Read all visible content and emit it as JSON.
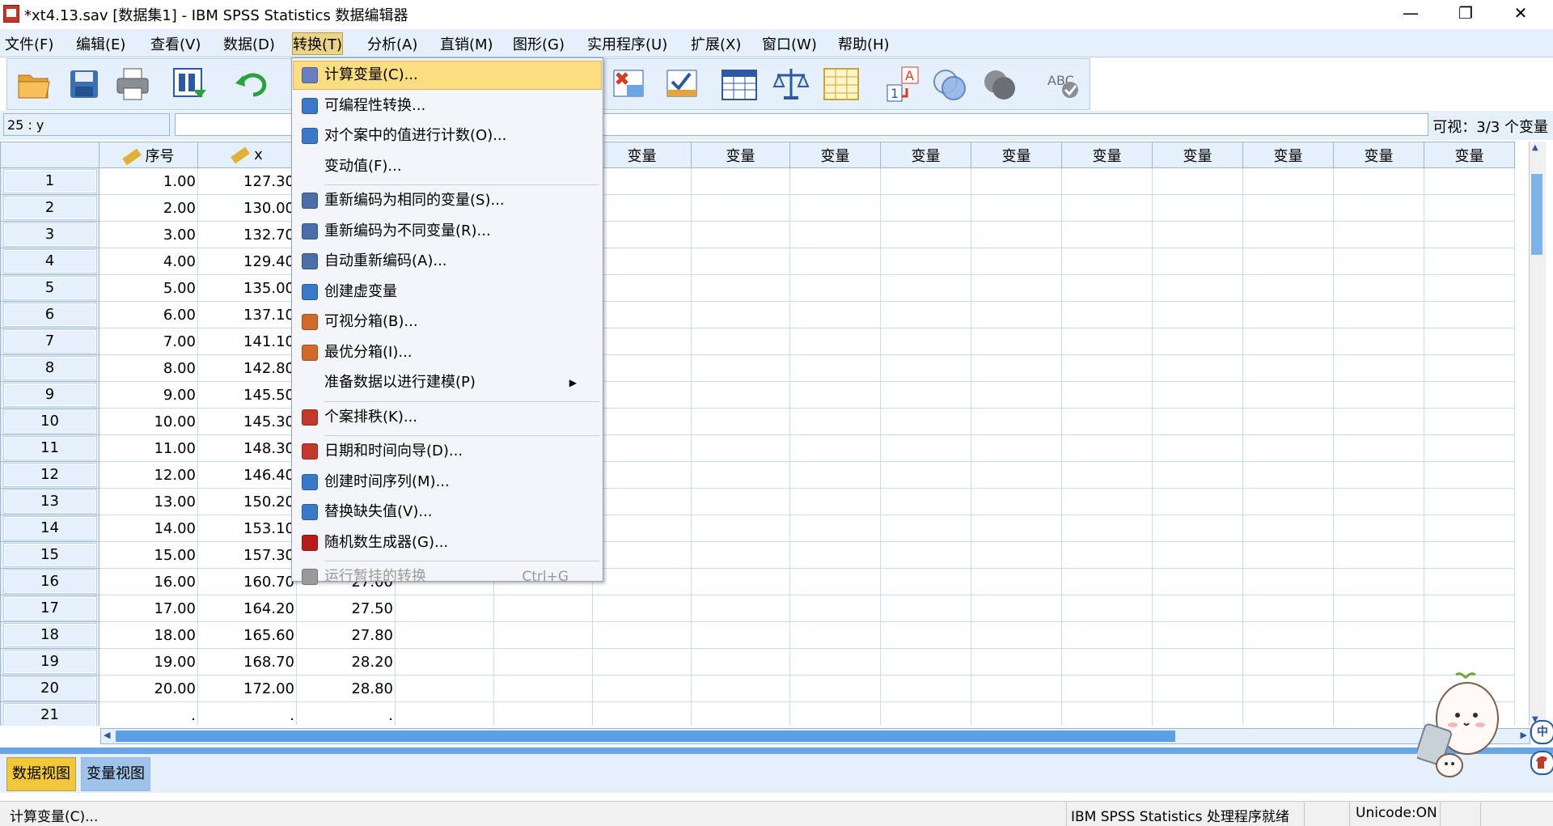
{
  "window": {
    "title": "*xt4.13.sav [数据集1] - IBM SPSS Statistics 数据编辑器",
    "minimize": "—",
    "restore": "❐",
    "close": "✕"
  },
  "menubar": [
    {
      "label": "文件(F)"
    },
    {
      "label": "编辑(E)"
    },
    {
      "label": "查看(V)"
    },
    {
      "label": "数据(D)"
    },
    {
      "label": "转换(T)"
    },
    {
      "label": "分析(A)"
    },
    {
      "label": "直销(M)"
    },
    {
      "label": "图形(G)"
    },
    {
      "label": "实用程序(U)"
    },
    {
      "label": "扩展(X)"
    },
    {
      "label": "窗口(W)"
    },
    {
      "label": "帮助(H)"
    }
  ],
  "cellbar": {
    "ref": "25 : y",
    "visible": "可视：3/3 个变量"
  },
  "grid": {
    "columns": [
      "序号",
      "x",
      "y",
      "变量",
      "变量",
      "变量",
      "变量",
      "变量",
      "变量",
      "变量",
      "变量",
      "变量",
      "变量",
      "变量",
      "变量"
    ],
    "rows": [
      [
        "1",
        "1.00",
        "127.30",
        ""
      ],
      [
        "2",
        "2.00",
        "130.00",
        ""
      ],
      [
        "3",
        "3.00",
        "132.70",
        ""
      ],
      [
        "4",
        "4.00",
        "129.40",
        ""
      ],
      [
        "5",
        "5.00",
        "135.00",
        ""
      ],
      [
        "6",
        "6.00",
        "137.10",
        ""
      ],
      [
        "7",
        "7.00",
        "141.10",
        ""
      ],
      [
        "8",
        "8.00",
        "142.80",
        ""
      ],
      [
        "9",
        "9.00",
        "145.50",
        ""
      ],
      [
        "10",
        "10.00",
        "145.30",
        ""
      ],
      [
        "11",
        "11.00",
        "148.30",
        ""
      ],
      [
        "12",
        "12.00",
        "146.40",
        ""
      ],
      [
        "13",
        "13.00",
        "150.20",
        ""
      ],
      [
        "14",
        "14.00",
        "153.10",
        ""
      ],
      [
        "15",
        "15.00",
        "157.30",
        ""
      ],
      [
        "16",
        "16.00",
        "160.70",
        "27.00"
      ],
      [
        "17",
        "17.00",
        "164.20",
        "27.50"
      ],
      [
        "18",
        "18.00",
        "165.60",
        "27.80"
      ],
      [
        "19",
        "19.00",
        "168.70",
        "28.20"
      ],
      [
        "20",
        "20.00",
        "172.00",
        "28.80"
      ],
      [
        "21",
        ".",
        ".",
        "."
      ]
    ]
  },
  "dropdown": {
    "items": [
      {
        "label": "计算变量(C)...",
        "icon": "calculator-icon",
        "icon_color": "#6a7fbf",
        "highlighted": true
      },
      {
        "label": "可编程性转换...",
        "icon": "plus-icon",
        "icon_color": "#3a78c9"
      },
      {
        "label": "对个案中的值进行计数(O)...",
        "icon": "count-icon",
        "icon_color": "#3a78c9"
      },
      {
        "label": "变动值(F)...",
        "icon": ""
      },
      {
        "separator": true
      },
      {
        "label": "重新编码为相同的变量(S)...",
        "icon": "recode-icon",
        "icon_color": "#4a6fa8"
      },
      {
        "label": "重新编码为不同变量(R)...",
        "icon": "recode-icon",
        "icon_color": "#4a6fa8"
      },
      {
        "label": "自动重新编码(A)...",
        "icon": "auto-recode-icon",
        "icon_color": "#4a6fa8"
      },
      {
        "label": "创建虚变量",
        "icon": "plus-icon",
        "icon_color": "#3a78c9"
      },
      {
        "label": "可视分箱(B)...",
        "icon": "bin-icon",
        "icon_color": "#d06a2a"
      },
      {
        "label": "最优分箱(I)...",
        "icon": "optimal-bin-icon",
        "icon_color": "#d06a2a"
      },
      {
        "label": "准备数据以进行建模(P)",
        "icon": "",
        "submenu": true
      },
      {
        "separator": true
      },
      {
        "label": "个案排秩(K)...",
        "icon": "rank-icon",
        "icon_color": "#c0392b"
      },
      {
        "separator": true
      },
      {
        "label": "日期和时间向导(D)...",
        "icon": "calendar-icon",
        "icon_color": "#c0392b"
      },
      {
        "label": "创建时间序列(M)...",
        "icon": "time-series-icon",
        "icon_color": "#3a78c9"
      },
      {
        "label": "替换缺失值(V)...",
        "icon": "missing-values-icon",
        "icon_color": "#3a78c9"
      },
      {
        "label": "随机数生成器(G)...",
        "icon": "dice-icon",
        "icon_color": "#b71c1c"
      },
      {
        "separator": true
      },
      {
        "label": "运行暂挂的转换",
        "icon": "run-icon",
        "icon_color": "#9a9a9a",
        "shortcut": "Ctrl+G",
        "disabled": true
      }
    ],
    "submenu_arrow": "▶"
  },
  "tabs": {
    "data_view": "数据视图",
    "variable_view": "变量视图"
  },
  "status": {
    "left": "计算变量(C)...",
    "processor": "IBM SPSS Statistics 处理程序就绪",
    "unicode": "Unicode:ON"
  },
  "scroll": {
    "left_arrow": "◀",
    "right_arrow": "▶",
    "up_arrow": "▲",
    "down_arrow": "▼"
  }
}
